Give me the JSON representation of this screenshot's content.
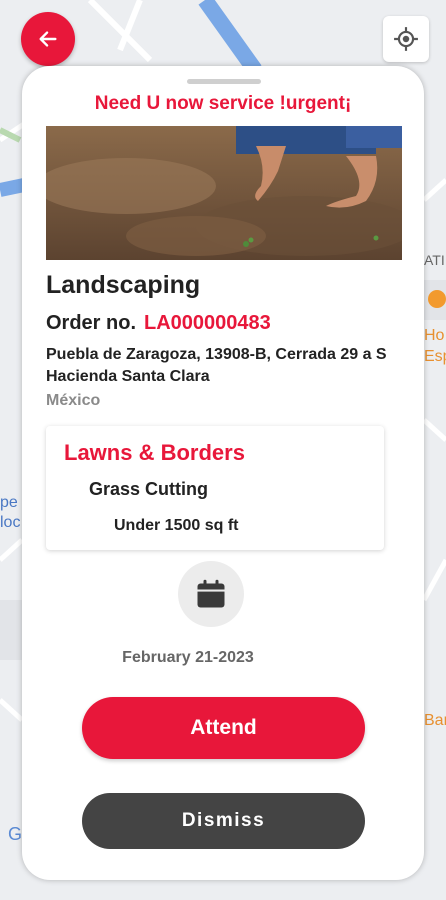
{
  "header": {
    "back_icon": "arrow-left-icon",
    "location_icon": "my-location-icon"
  },
  "map": {
    "labels": {
      "right_top": "ATI",
      "right_mid1": "Ho",
      "right_mid2": "Esp",
      "right_bottom": "Bar",
      "left_mid1": "pe",
      "left_mid2": "loc",
      "bottom_left": "G"
    }
  },
  "sheet": {
    "urgent_title": "Need U now service !urgent¡",
    "service_name": "Landscaping",
    "order_label": "Order no.",
    "order_number": "LA000000483",
    "address": "Puebla de Zaragoza, 13908-B, Cerrada 29 a S Hacienda Santa Clara",
    "country": "México",
    "service": {
      "category": "Lawns & Borders",
      "item": "Grass Cutting",
      "size": "Under 1500 sq ft"
    },
    "calendar_icon": "calendar-icon",
    "date": "February 21-2023",
    "attend_label": "Attend",
    "dismiss_label": "Dismiss"
  },
  "colors": {
    "accent": "#e8173a",
    "dark_button": "#444444",
    "muted_text": "#8a8a8a"
  }
}
